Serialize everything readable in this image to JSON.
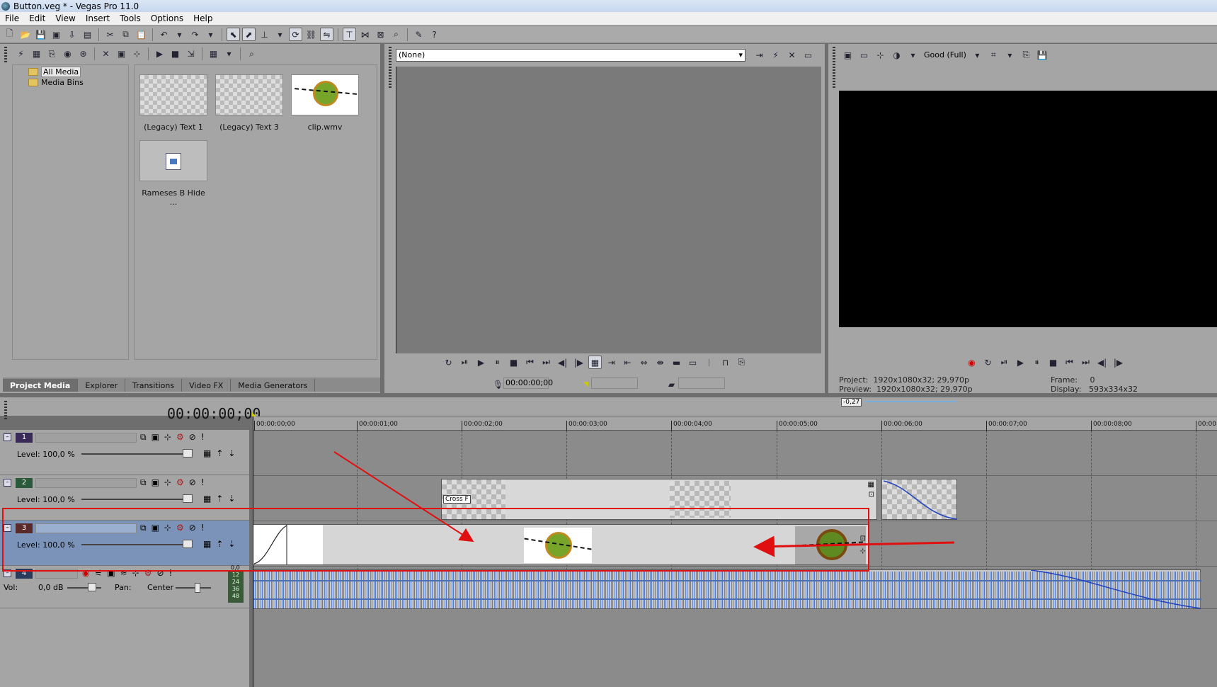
{
  "window": {
    "title": "Button.veg * - Vegas Pro 11.0"
  },
  "menu": [
    "File",
    "Edit",
    "View",
    "Insert",
    "Tools",
    "Options",
    "Help"
  ],
  "project_media": {
    "tree": [
      {
        "label": "All Media",
        "selected": true
      },
      {
        "label": "Media Bins",
        "selected": false
      }
    ],
    "items": [
      {
        "caption": "(Legacy) Text 1"
      },
      {
        "caption": "(Legacy) Text 3"
      },
      {
        "caption": "clip.wmv"
      },
      {
        "caption": "Rameses B Hide ..."
      }
    ],
    "tabs": [
      "Project Media",
      "Explorer",
      "Transitions",
      "Video FX",
      "Media Generators"
    ],
    "active_tab": "Project Media"
  },
  "trimmer": {
    "source_select": "(None)",
    "timecode": "00:00:00;00"
  },
  "preview": {
    "quality": "Good (Full)",
    "project_label": "Project:",
    "project_value": "1920x1080x32; 29,970p",
    "preview_label": "Preview:",
    "preview_value": "1920x1080x32; 29,970p",
    "frame_label": "Frame:",
    "frame_value": "0",
    "display_label": "Display:",
    "display_value": "593x334x32"
  },
  "timeline": {
    "current_time": "00:00:00;00",
    "rate_badge": "-0,27",
    "ruler": [
      "00:00:00;00",
      "00:00:01;00",
      "00:00:02;00",
      "00:00:03;00",
      "00:00:04;00",
      "00:00:05;00",
      "00:00:06;00",
      "00:00:07;00",
      "00:00:08;00",
      "00:00:0"
    ],
    "tracks": [
      {
        "number": "1",
        "level": "Level: 100,0 %",
        "type": "video"
      },
      {
        "number": "2",
        "level": "Level: 100,0 %",
        "type": "video"
      },
      {
        "number": "3",
        "level": "Level: 100,0 %",
        "type": "video",
        "selected": true
      },
      {
        "number": "4",
        "vol": "Vol:",
        "vol_value": "0,0 dB",
        "pan": "Pan:",
        "pan_value": "Center",
        "type": "audio"
      }
    ],
    "crossfade_label": "Cross F",
    "meter_labels": [
      "12",
      "24",
      "36",
      "48"
    ],
    "meter_top": "0,0"
  },
  "colors": {
    "annotation": "#e01010",
    "selected_track": "#7b93b8",
    "waveform": "#4f73b8"
  }
}
